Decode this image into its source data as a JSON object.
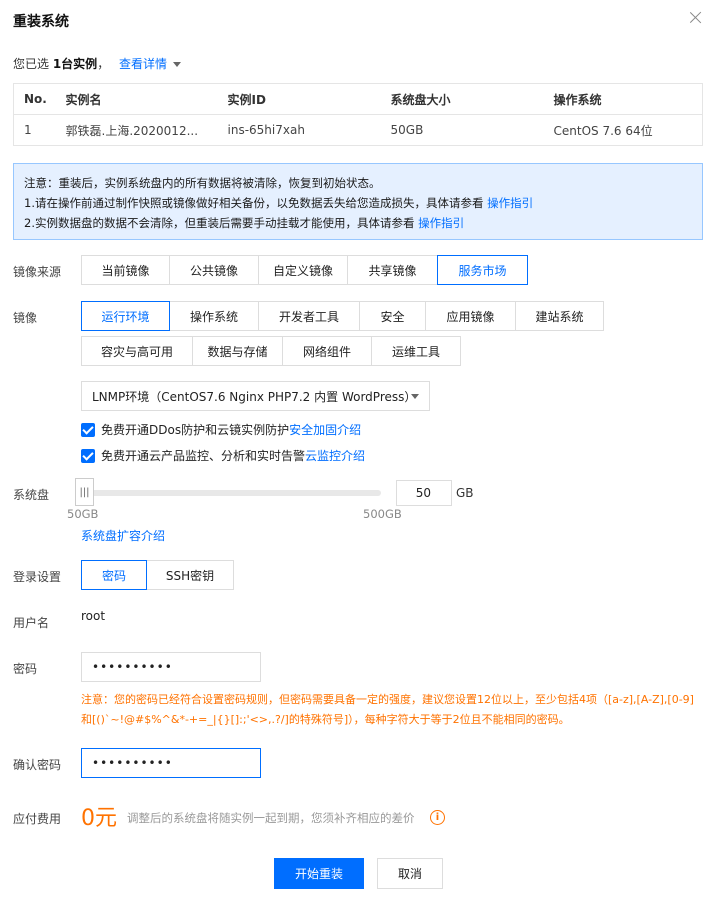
{
  "dialog": {
    "title": "重装系统"
  },
  "selection": {
    "prefix": "您已选 ",
    "count": "1台实例",
    "suffix": "，",
    "details_link": "查看详情"
  },
  "table": {
    "headers": [
      "No.",
      "实例名",
      "实例ID",
      "系统盘大小",
      "操作系统"
    ],
    "rows": [
      [
        "1",
        "郭铁磊.上海.2020012...",
        "ins-65hi7xah",
        "50GB",
        "CentOS 7.6 64位"
      ]
    ]
  },
  "notice": {
    "line1": "注意：重装后，实例系统盘内的所有数据将被清除，恢复到初始状态。",
    "line2": "1.请在操作前通过制作快照或镜像做好相关备份，以免数据丢失给您造成损失，具体请参看 ",
    "line3": "2.实例数据盘的数据不会清除，但重装后需要手动挂载才能使用，具体请参看 ",
    "link": "操作指引"
  },
  "image_source": {
    "label": "镜像来源",
    "tabs": [
      "当前镜像",
      "公共镜像",
      "自定义镜像",
      "共享镜像",
      "服务市场"
    ],
    "active": 4
  },
  "image": {
    "label": "镜像",
    "categories_row1": [
      "运行环境",
      "操作系统",
      "开发者工具",
      "安全",
      "应用镜像",
      "建站系统"
    ],
    "categories_row2": [
      "容灾与高可用",
      "数据与存储",
      "网络组件",
      "运维工具"
    ],
    "active": 0,
    "selected": "LNMP环境（CentOS7.6 Nginx PHP7.2 内置 WordPress）"
  },
  "options": {
    "ddos_text": "免费开通DDos防护和云镜实例防护 ",
    "ddos_link": "安全加固介绍",
    "monitor_text": "免费开通云产品监控、分析和实时告警 ",
    "monitor_link": "云监控介绍"
  },
  "disk": {
    "label": "系统盘",
    "value": "50",
    "unit": "GB",
    "min": "50GB",
    "max": "500GB",
    "expand_link": "系统盘扩容介绍",
    "handle": "|||"
  },
  "login": {
    "label": "登录设置",
    "tabs": [
      "密码",
      "SSH密钥"
    ],
    "active": 0
  },
  "user": {
    "label": "用户名",
    "value": "root"
  },
  "password": {
    "label": "密码",
    "value": "••••••••••",
    "warning": "注意：您的密码已经符合设置密码规则，但密码需要具备一定的强度，建议您设置12位以上，至少包括4项（[a-z],[A-Z],[0-9]和[()`~!@#$%^&*-+=_|{}[]:;'<>,.?/]的特殊符号]），每种字符大于等于2位且不能相同的密码。"
  },
  "confirm": {
    "label": "确认密码",
    "value": "••••••••••"
  },
  "fee": {
    "label": "应付费用",
    "amount": "0元",
    "note": "调整后的系统盘将随实例一起到期，您须补齐相应的差价",
    "info": "i"
  },
  "actions": {
    "primary": "开始重装",
    "cancel": "取消"
  },
  "colors": {
    "accent": "#006eff",
    "warning": "#ff7200",
    "notice_bg": "#e5f0ff"
  }
}
